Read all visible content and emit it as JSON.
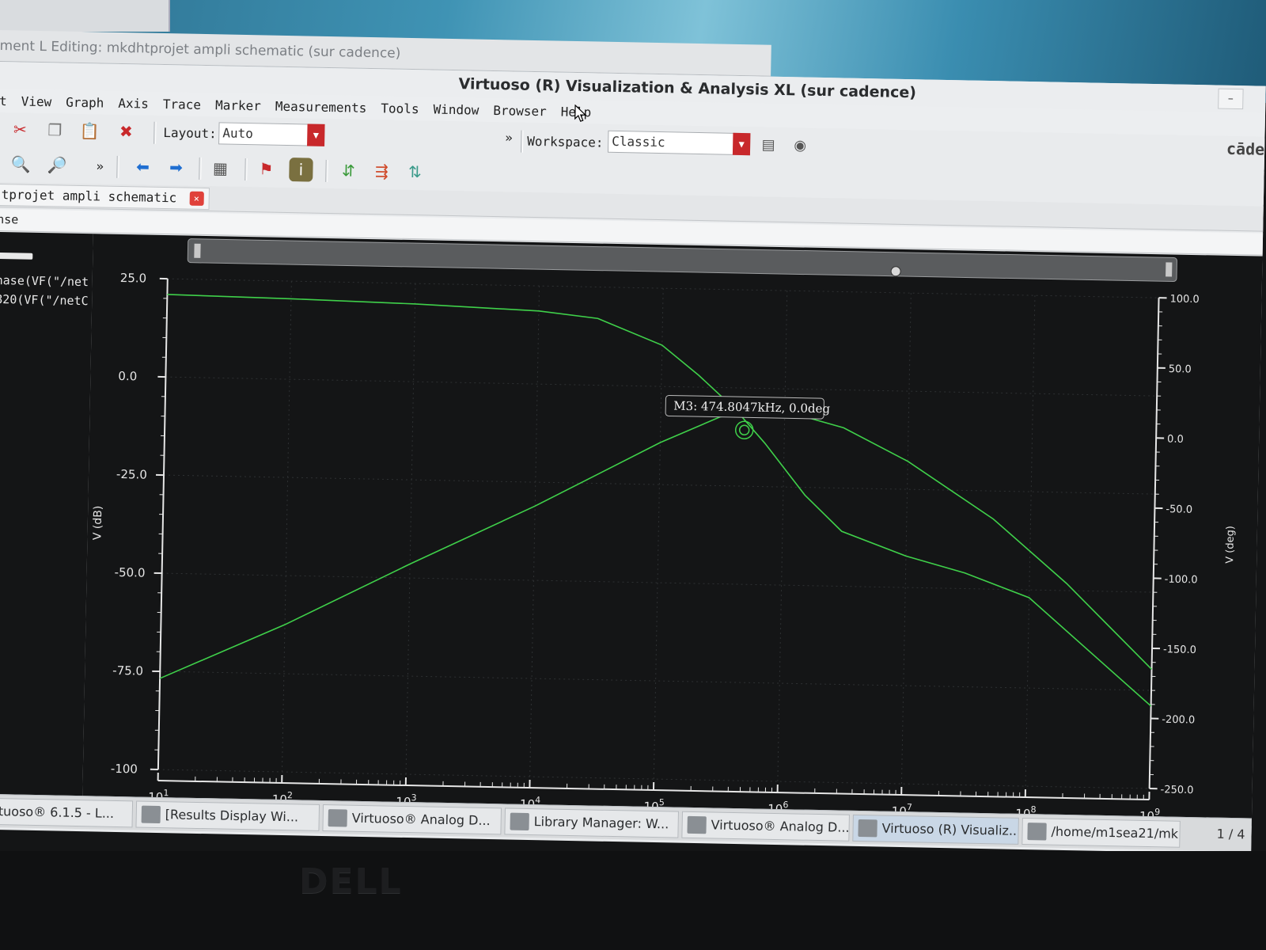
{
  "back_window": {
    "title": "ment L Editing: mkdhtprojet ampli schematic (sur cadence)"
  },
  "window": {
    "title": "Virtuoso (R) Visualization & Analysis XL (sur cadence)",
    "control": "–"
  },
  "menu": [
    "t",
    "View",
    "Graph",
    "Axis",
    "Trace",
    "Marker",
    "Measurements",
    "Tools",
    "Window",
    "Browser",
    "Help"
  ],
  "toolbar": {
    "layout_label": "Layout:",
    "layout_value": "Auto",
    "overflow": "»",
    "workspace_label": "Workspace:",
    "workspace_value": "Classic",
    "brand": "cāde"
  },
  "tab": {
    "label": "tprojet ampli schematic",
    "close": "×"
  },
  "subbar": {
    "text": "nse"
  },
  "traces_panel": [
    "nase(VF(\"/net",
    "820(VF(\"/netC"
  ],
  "chart_data": {
    "type": "line",
    "xscale": "log",
    "xlim": [
      10,
      1000000000
    ],
    "x_ticks": [
      {
        "base": "10",
        "exp": "1"
      },
      {
        "base": "10",
        "exp": "2"
      },
      {
        "base": "10",
        "exp": "3"
      },
      {
        "base": "10",
        "exp": "4"
      },
      {
        "base": "10",
        "exp": "5"
      },
      {
        "base": "10",
        "exp": "6"
      },
      {
        "base": "10",
        "exp": "7"
      },
      {
        "base": "10",
        "exp": "8"
      },
      {
        "base": "10",
        "exp": "9"
      }
    ],
    "ylabel_left": "V (dB)",
    "ylim_left": [
      -100,
      25
    ],
    "y_ticks_left": [
      "25.0",
      "0.0",
      "-25.0",
      "-50.0",
      "-75.0",
      "-100"
    ],
    "ylabel_right": "V (deg)",
    "ylim_right": [
      -250,
      100
    ],
    "y_ticks_right": [
      "100.0",
      "50.0",
      "0.0",
      "-50.0",
      "-100.0",
      "-150.0",
      "-200.0",
      "-250.0"
    ],
    "grid": true,
    "series": [
      {
        "axis": "left",
        "color": "#3fd04a",
        "x": [
          10,
          100,
          1000,
          10000,
          30000,
          100000,
          200000,
          400000,
          700000,
          1500000,
          3000000,
          10000000,
          30000000,
          100000000,
          1000000000
        ],
        "y": [
          21,
          20.5,
          19.8,
          18.6,
          17.0,
          10.5,
          3.0,
          -5.5,
          -14,
          -27,
          -36,
          -42,
          -46,
          -52,
          -79
        ]
      },
      {
        "axis": "right",
        "color": "#3fd04a",
        "x": [
          10,
          100,
          1000,
          10000,
          100000,
          300000,
          600000,
          1000000,
          3000000,
          10000000,
          50000000,
          200000000,
          1000000000
        ],
        "y": [
          -185,
          -145,
          -100,
          -57,
          -10,
          9,
          15,
          14,
          3,
          -20,
          -60,
          -105,
          -165
        ]
      }
    ],
    "marker": {
      "label": "M3: 474.8047kHz, 0.0deg",
      "x": 474804.7,
      "y": 0.0,
      "axis": "right"
    }
  },
  "taskbar": {
    "items": [
      {
        "label": "irtuoso® 6.1.5 - L...",
        "active": false
      },
      {
        "label": "[Results Display Wi...",
        "active": false
      },
      {
        "label": "Virtuoso® Analog D...",
        "active": false
      },
      {
        "label": "Library Manager: W...",
        "active": false
      },
      {
        "label": "Virtuoso® Analog D...",
        "active": false
      },
      {
        "label": "Virtuoso (R) Visualiz...",
        "active": true
      },
      {
        "label": "/home/m1sea21/mk...",
        "active": false
      }
    ],
    "pager": "1 / 4"
  },
  "monitor": {
    "brand": "DELL"
  }
}
